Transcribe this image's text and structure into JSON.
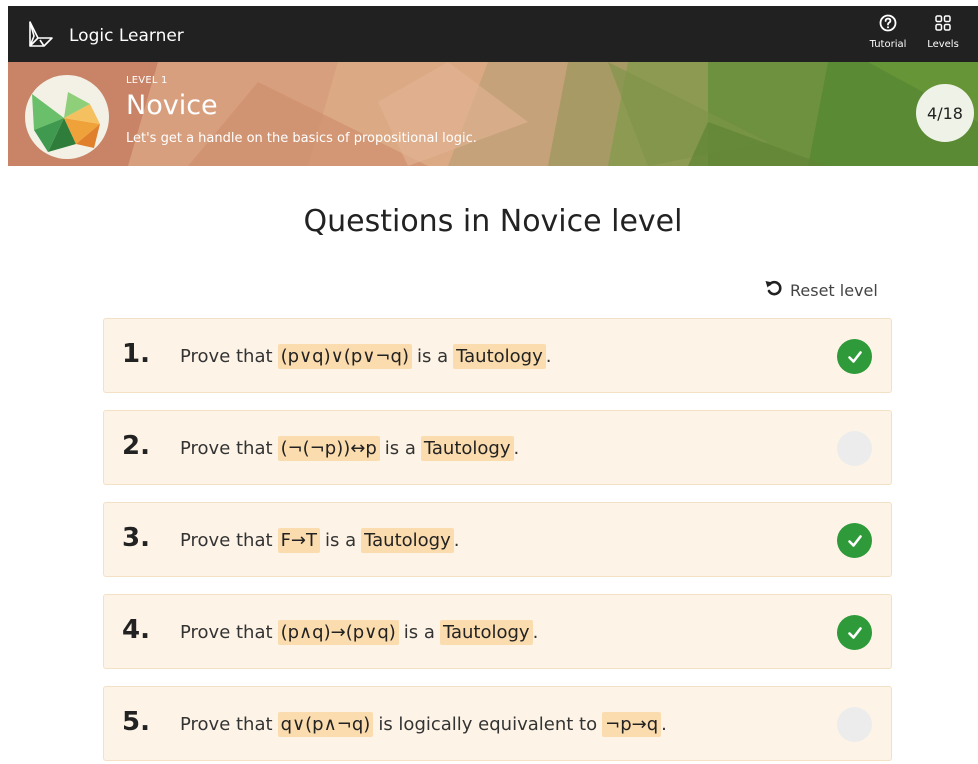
{
  "app": {
    "title": "Logic Learner"
  },
  "nav": {
    "tutorial_label": "Tutorial",
    "levels_label": "Levels"
  },
  "banner": {
    "level_tag": "LEVEL 1",
    "level_name": "Novice",
    "description": "Let's get a handle on the basics of propositional logic.",
    "progress": "4/18"
  },
  "main": {
    "title": "Questions in Novice level",
    "reset_label": "Reset level"
  },
  "questions": [
    {
      "number": "1.",
      "prefix": "Prove that",
      "expr": "(p∨q)∨(p∨¬q)",
      "middle": "is a",
      "target": "Tautology",
      "suffix": ".",
      "completed": true
    },
    {
      "number": "2.",
      "prefix": "Prove that",
      "expr": "(¬(¬p))↔p",
      "middle": "is a",
      "target": "Tautology",
      "suffix": ".",
      "completed": false
    },
    {
      "number": "3.",
      "prefix": "Prove that",
      "expr": "F→T",
      "middle": "is a",
      "target": "Tautology",
      "suffix": ".",
      "completed": true
    },
    {
      "number": "4.",
      "prefix": "Prove that",
      "expr": "(p∧q)→(p∨q)",
      "middle": "is a",
      "target": "Tautology",
      "suffix": ".",
      "completed": true
    },
    {
      "number": "5.",
      "prefix": "Prove that",
      "expr": "q∨(p∧¬q)",
      "middle": "is logically equivalent to",
      "target": "¬p→q",
      "suffix": ".",
      "completed": false
    }
  ],
  "colors": {
    "topbar": "#212121",
    "card_bg": "#fdf4e7",
    "highlight": "#fbdcae",
    "done": "#2e9a3a",
    "todo": "#ececec"
  },
  "icons": {
    "brand": "logic-bird-icon",
    "tutorial": "question-circle-icon",
    "levels": "grid-icon",
    "reset": "undo-icon",
    "done": "check-icon"
  }
}
